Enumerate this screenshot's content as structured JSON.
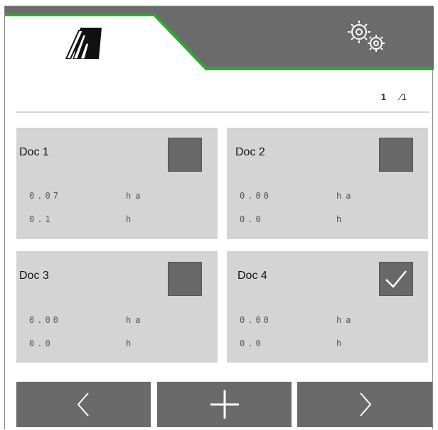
{
  "tabs": [
    {
      "icon": "field-documentation-icon",
      "active": true
    },
    {
      "icon": "settings-gears-icon",
      "active": false
    }
  ],
  "accent_color": "#2fa832",
  "page": {
    "current": "1",
    "total": "⁄1"
  },
  "documents": [
    {
      "name": "Doc 1",
      "area_value": "0.07",
      "area_unit": "ha",
      "time_value": "0.1",
      "time_unit": "h",
      "checked": false
    },
    {
      "name": "Doc 2",
      "area_value": "0.00",
      "area_unit": "ha",
      "time_value": "0.0",
      "time_unit": "h",
      "checked": false
    },
    {
      "name": "Doc 3",
      "area_value": "0.00",
      "area_unit": "ha",
      "time_value": "0.0",
      "time_unit": "h",
      "checked": false
    },
    {
      "name": "Doc 4",
      "area_value": "0.00",
      "area_unit": "ha",
      "time_value": "0.0",
      "time_unit": "h",
      "checked": true
    }
  ],
  "toolbar": {
    "prev": "chevron-left-icon",
    "add": "plus-icon",
    "next": "chevron-right-icon"
  }
}
